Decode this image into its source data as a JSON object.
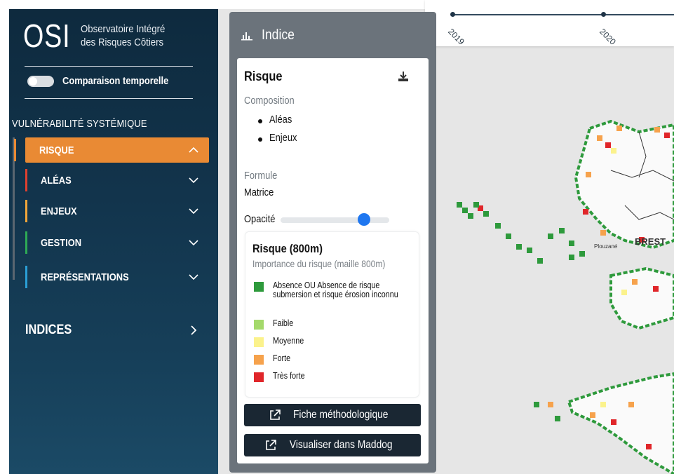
{
  "sidebar": {
    "logo_mark": "OSI",
    "logo_line1": "Observatoire Intégré",
    "logo_line2": "des Risques Côtiers",
    "toggle_label": "Comparaison temporelle",
    "section_title": "VULNÉRABILITÉ SYSTÉMIQUE",
    "items": [
      {
        "label": "RISQUE",
        "color": "#e98a34",
        "state": "expanded"
      },
      {
        "label": "ALÉAS",
        "color": "#e0402f",
        "state": "collapsed"
      },
      {
        "label": "ENJEUX",
        "color": "#f2a63a",
        "state": "collapsed"
      },
      {
        "label": "GESTION",
        "color": "#2eaa55",
        "state": "collapsed"
      },
      {
        "label": "REPRÉSENTATIONS",
        "color": "#2a9fd6",
        "state": "collapsed"
      }
    ],
    "indices_label": "INDICES"
  },
  "timeline": {
    "years": [
      "2019",
      "2020"
    ]
  },
  "panel": {
    "header": "Indice",
    "title": "Risque",
    "composition_label": "Composition",
    "composition_items": [
      "Aléas",
      "Enjeux"
    ],
    "formule_label": "Formule",
    "formule_value": "Matrice",
    "opacity_label": "Opacité",
    "opacity_value": 0.8,
    "legend": {
      "title": "Risque (800m)",
      "subtitle": "Importance du risque (maille 800m)",
      "items": [
        {
          "label": "Absence OU Absence de risque submersion et risque érosion inconnu",
          "color": "#2e9a3c"
        },
        {
          "label": "Faible",
          "color": "#a4d96b"
        },
        {
          "label": "Moyenne",
          "color": "#fbf28c"
        },
        {
          "label": "Forte",
          "color": "#f6a24c"
        },
        {
          "label": "Très forte",
          "color": "#e0262a"
        }
      ]
    },
    "buttons": {
      "fiche": "Fiche méthodologique",
      "maddog": "Visualiser dans Maddog"
    }
  },
  "map": {
    "place_1": "Plouzané",
    "place_2": "BREST"
  }
}
